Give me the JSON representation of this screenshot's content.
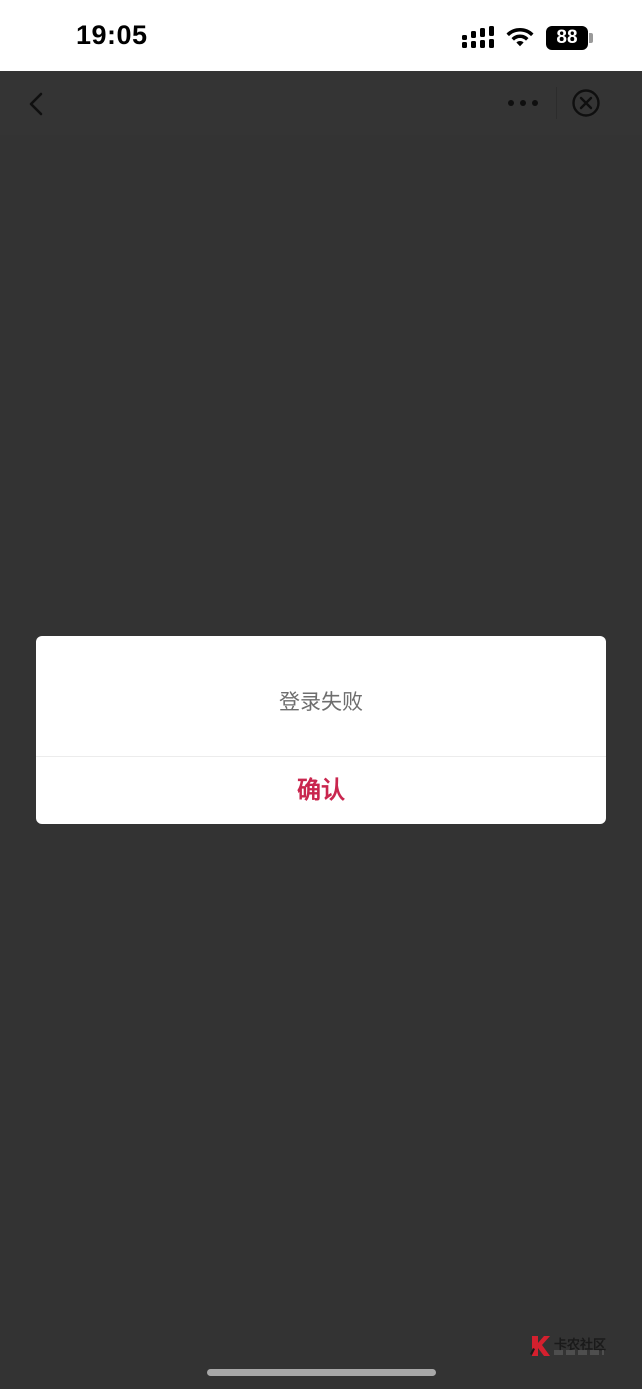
{
  "status_bar": {
    "time": "19:05",
    "battery_level": "88",
    "signal_icon": "cellular-signal-icon",
    "wifi_icon": "wifi-icon"
  },
  "nav_bar": {
    "back_icon": "chevron-left-icon",
    "more_icon": "more-dots-icon",
    "close_icon": "close-circle-icon"
  },
  "dialog": {
    "message": "登录失败",
    "confirm_label": "确认"
  },
  "watermark": {
    "logo_icon": "kanong-logo-icon",
    "title": "卡农社区"
  },
  "colors": {
    "background": "#333333",
    "accent": "#c9264e",
    "dialog_background": "#ffffff",
    "message_text": "#6e6e6e"
  }
}
